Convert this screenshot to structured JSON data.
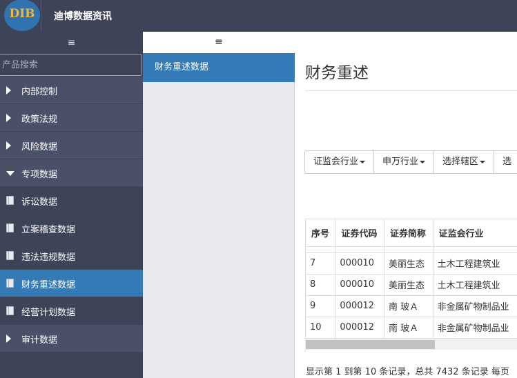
{
  "app": {
    "logo_text": "DIB",
    "title": "迪博数据资讯"
  },
  "sidebar": {
    "toggle_glyph": "≡",
    "search_placeholder": "产品搜索",
    "items": [
      {
        "label": "内部控制",
        "icon": "caret-right-icon",
        "type": "group"
      },
      {
        "label": "政策法规",
        "icon": "caret-right-icon",
        "type": "group"
      },
      {
        "label": "风险数据",
        "icon": "caret-right-icon",
        "type": "group"
      },
      {
        "label": "专项数据",
        "icon": "caret-down-icon",
        "type": "group-open"
      },
      {
        "label": "诉讼数据",
        "icon": "book-icon",
        "type": "sub"
      },
      {
        "label": "立案稽查数据",
        "icon": "book-icon",
        "type": "sub"
      },
      {
        "label": "违法违规数据",
        "icon": "book-icon",
        "type": "sub"
      },
      {
        "label": "财务重述数据",
        "icon": "book-icon",
        "type": "sub-active"
      },
      {
        "label": "经营计划数据",
        "icon": "book-icon",
        "type": "sub"
      },
      {
        "label": "审计数据",
        "icon": "caret-right-icon",
        "type": "group"
      }
    ]
  },
  "subpanel": {
    "toggle_glyph": "≡",
    "active_item": "财务重述数据"
  },
  "main": {
    "page_title": "财务重述",
    "filters": [
      "证监会行业",
      "申万行业",
      "选择辖区",
      "选"
    ],
    "table": {
      "headers": [
        "序号",
        "证券代码",
        "证券简称",
        "证监会行业"
      ],
      "rows": [
        [
          "7",
          "000010",
          "美丽生态",
          "土木工程建筑业"
        ],
        [
          "8",
          "000010",
          "美丽生态",
          "土木工程建筑业"
        ],
        [
          "9",
          "000012",
          "南 玻Ａ",
          "非金属矿物制品业"
        ],
        [
          "10",
          "000012",
          "南 玻Ａ",
          "非金属矿物制品业"
        ]
      ]
    },
    "pager_info": "显示第 1 到第 10 条记录，总共 7432 条记录 每页"
  },
  "colors": {
    "topbar": "#3e4458",
    "sidebar": "#3e4458",
    "active": "#337ab7",
    "logo_accent": "#f3b43c"
  }
}
